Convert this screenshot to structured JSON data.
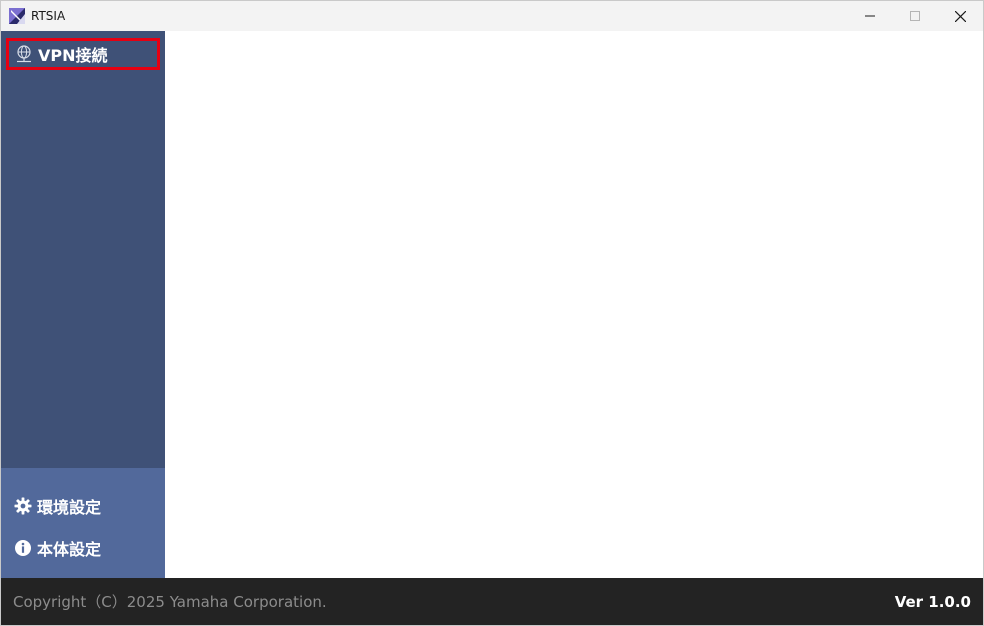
{
  "window": {
    "title": "RTSIA"
  },
  "sidebar": {
    "nav_vpn": {
      "label": "VPN接続",
      "icon": "vpn-globe-icon",
      "selected": true
    },
    "nav_environment": {
      "label": "環境設定",
      "icon": "gear-icon"
    },
    "nav_device": {
      "label": "本体設定",
      "icon": "info-icon"
    }
  },
  "footer": {
    "copyright": "Copyright（C）2025 Yamaha Corporation.",
    "version": "Ver 1.0.0"
  },
  "colors": {
    "sidebar_top": "#3f5177",
    "sidebar_bottom": "#52699b",
    "selection_border": "#e60012",
    "footer_bg": "#232323"
  }
}
